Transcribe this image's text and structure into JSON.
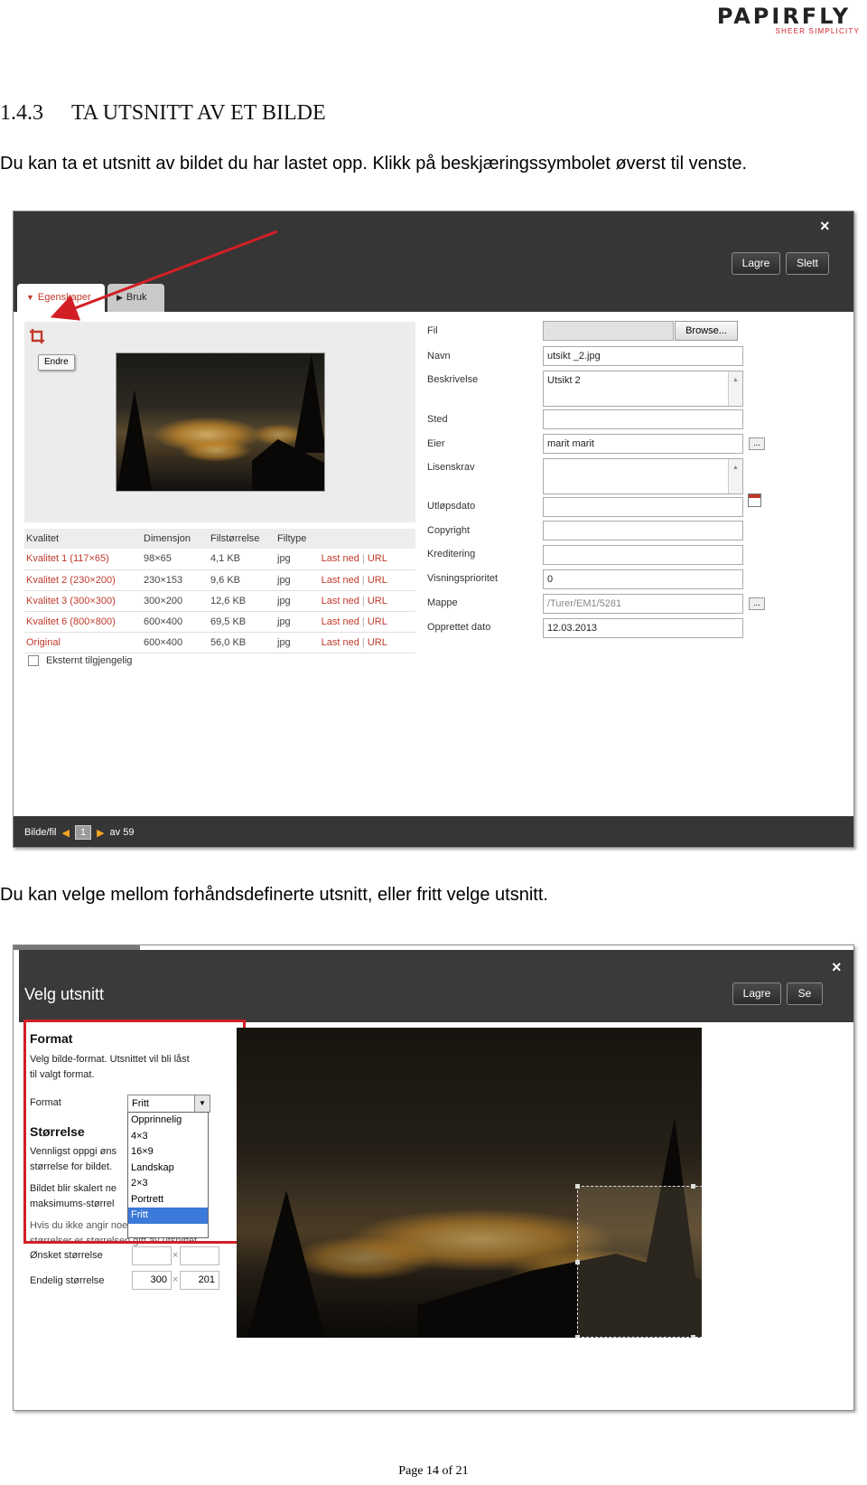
{
  "header": {
    "logo_word": "PAPIRFLY",
    "logo_tagline": "SHEER SIMPLICITY"
  },
  "section": {
    "number": "1.4.3",
    "title": "TA UTSNITT AV ET BILDE",
    "para1": "Du kan ta et utsnitt av bildet du har lastet opp. Klikk på beskjæringssymbolet øverst til venste.",
    "para2": "Du kan velge mellom forhåndsdefinerte utsnitt, eller fritt velge utsnitt."
  },
  "screenshot1": {
    "close": "×",
    "buttons": {
      "save": "Lagre",
      "delete": "Slett"
    },
    "tabs": [
      {
        "label": "Egenskaper"
      },
      {
        "label": "Bruk"
      }
    ],
    "edit_tooltip": "Endre",
    "icons": {
      "crop": "crop-icon",
      "close": "close-icon",
      "calendar": "calendar-icon"
    },
    "colors": {
      "accent": "#c0392b",
      "dark_bar": "#363636",
      "pager_arrow": "#f5a623"
    },
    "quality_table": {
      "headers": [
        "Kvalitet",
        "Dimensjon",
        "Filstørrelse",
        "Filtype"
      ],
      "rows": [
        {
          "quality": "Kvalitet 1 (117×65)",
          "dimension": "98×65",
          "size": "4,1 KB",
          "type": "jpg",
          "download": "Last ned",
          "url": "URL"
        },
        {
          "quality": "Kvalitet 2 (230×200)",
          "dimension": "230×153",
          "size": "9,6 KB",
          "type": "jpg",
          "download": "Last ned",
          "url": "URL"
        },
        {
          "quality": "Kvalitet 3 (300×300)",
          "dimension": "300×200",
          "size": "12,6 KB",
          "type": "jpg",
          "download": "Last ned",
          "url": "URL"
        },
        {
          "quality": "Kvalitet 6 (800×800)",
          "dimension": "600×400",
          "size": "69,5 KB",
          "type": "jpg",
          "download": "Last ned",
          "url": "URL"
        },
        {
          "quality": "Original",
          "dimension": "600×400",
          "size": "56,0 KB",
          "type": "jpg",
          "download": "Last ned",
          "url": "URL"
        }
      ]
    },
    "external_checkbox": "Eksternt tilgjengelig",
    "fields": {
      "file": {
        "label": "Fil",
        "browse": "Browse..."
      },
      "name": {
        "label": "Navn",
        "value": "utsikt _2.jpg"
      },
      "description": {
        "label": "Beskrivelse",
        "value": "Utsikt 2"
      },
      "place": {
        "label": "Sted",
        "value": ""
      },
      "owner": {
        "label": "Eier",
        "value": "marit marit"
      },
      "license": {
        "label": "Lisenskrav",
        "value": ""
      },
      "expiry": {
        "label": "Utløpsdato",
        "value": ""
      },
      "copyright": {
        "label": "Copyright",
        "value": ""
      },
      "credit": {
        "label": "Kreditering",
        "value": ""
      },
      "priority": {
        "label": "Visningsprioritet",
        "value": "0"
      },
      "folder": {
        "label": "Mappe",
        "value": "/Turer/EM1/5281"
      },
      "created": {
        "label": "Opprettet dato",
        "value": "12.03.2013"
      },
      "more_button": "..."
    },
    "pager": {
      "label": "Bilde/fil",
      "current": "1",
      "total": "av 59"
    }
  },
  "screenshot2": {
    "title": "Velg utsnitt",
    "close": "×",
    "buttons": {
      "save": "Lagre",
      "other": "Se"
    },
    "format_heading": "Format",
    "format_text_1": "Velg bilde-format. Utsnittet vil bli låst",
    "format_text_2": "til valgt format.",
    "format_label": "Format",
    "format_selected": "Fritt",
    "format_options": [
      "Opprinnelig",
      "4×3",
      "16×9",
      "Landskap",
      "2×3",
      "Portrett",
      "Fritt"
    ],
    "size_heading": "Størrelse",
    "size_text_1": "Vennligst oppgi øns",
    "size_text_2": "størrelse for bildet.",
    "size_text_3": "Bildet blir skalert ne",
    "size_text_4": "maksimums-størrel",
    "size_text_5": "Hvis du ikke angir noen maksimums-",
    "size_text_6": "størrelser er størrelsen gitt av utsnittet",
    "wanted_size_label": "Ønsket størrelse",
    "wanted_w": "",
    "wanted_h": "",
    "final_size_label": "Endelig størrelse",
    "final_w": "300",
    "final_h": "201",
    "times": "×",
    "highlight_color": "#d21f26"
  },
  "footer": {
    "page": "Page 14 of 21"
  }
}
